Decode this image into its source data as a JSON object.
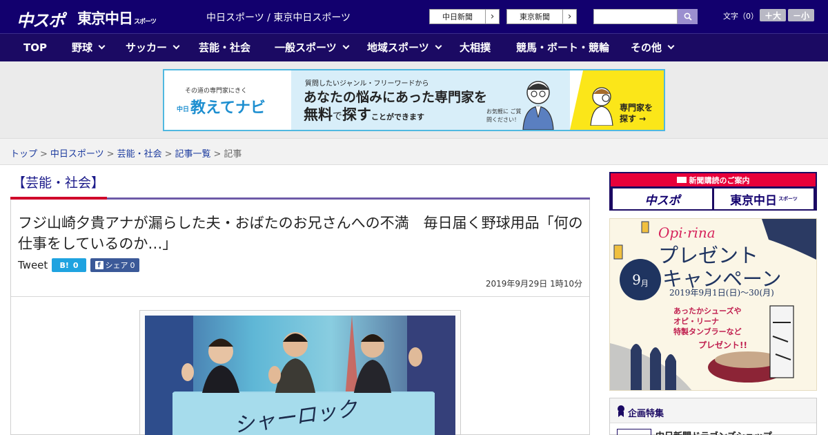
{
  "header": {
    "logo_chuspo": "中スポ",
    "logo_tokyo": "東京中日",
    "logo_tokyo_sub": "スポーツ",
    "site_name": "中日スポーツ / 東京中日スポーツ",
    "link1": "中日新聞",
    "link2": "東京新聞",
    "search_placeholder": "",
    "font_label": "文字（0）",
    "font_large": "＋大",
    "font_small": "－小"
  },
  "nav": {
    "items": [
      {
        "label": "TOP"
      },
      {
        "label": "野球"
      },
      {
        "label": "サッカー"
      },
      {
        "label": "芸能・社会"
      },
      {
        "label": "一般スポーツ"
      },
      {
        "label": "地域スポーツ"
      },
      {
        "label": "大相撲"
      },
      {
        "label": "競馬・ボート・競輪"
      },
      {
        "label": "その他"
      }
    ]
  },
  "ad": {
    "small": "その道の専門家にきく",
    "brand_prefix": "中日",
    "brand": "教えてナビ",
    "line1": "質問したいジャンル・フリーワードから",
    "line2": "あなたの悩みにあった専門家を",
    "line3a": "無料",
    "line3b": "で",
    "line3c": "探す",
    "line3d": "ことができます",
    "note": "お気軽に ご質問ください！",
    "cta": "専門家を 探す →"
  },
  "breadcrumb": {
    "items": [
      "トップ",
      "中日スポーツ",
      "芸能・社会",
      "記事一覧"
    ],
    "current": "記事"
  },
  "article": {
    "category": "【芸能・社会】",
    "headline": "フジ山崎夕貴アナが漏らした夫・おばたのお兄さんへの不満　毎日届く野球用品「何の仕事をしているのか…」",
    "tweet": "Tweet",
    "hatena_label": "B!",
    "hatena_count": "0",
    "fb_label": "シェア",
    "fb_count": "0",
    "date": "2019年9月29日 1時10分",
    "photo_sign": "シャーロック"
  },
  "sidebar": {
    "subscription_title": "新聞購読のご案内",
    "sub1": "中スポ",
    "sub2": "東京中日",
    "sub2_small": "スポーツ",
    "promo_brand": "Opi·rina",
    "promo_title1": "プレゼント",
    "promo_title2": "キャンペーン",
    "promo_month": "9",
    "promo_month_unit": "月",
    "promo_period": "2019年9月1日(日)〜30(月)",
    "promo_desc1": "あったかシューズや",
    "promo_desc2": "オピ・リーナ",
    "promo_desc3": "特製タンブラーなど",
    "promo_present": "プレゼント!!",
    "feature_title": "企画特集",
    "feature_row": "中日新聞ドラゴンズショップ"
  }
}
